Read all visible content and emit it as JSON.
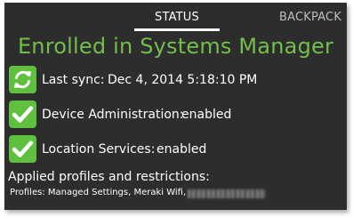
{
  "tabs": [
    {
      "label": "STATUS",
      "selected": true
    },
    {
      "label": "BACKPACK",
      "selected": false
    }
  ],
  "status": {
    "headline": "Enrolled in Systems Manager",
    "last_sync": {
      "label": "Last sync:",
      "value": "Dec 4, 2014 5:18:10 PM",
      "icon": "sync-icon"
    },
    "device_admin": {
      "label": "Device Administration:",
      "value": "enabled",
      "icon": "checkmark-icon"
    },
    "location_services": {
      "label": "Location Services:",
      "value": "enabled",
      "icon": "checkmark-icon"
    },
    "applied_heading": "Applied profiles and restrictions:",
    "profiles_text": "Profiles: Managed Settings, Meraki Wifi,"
  },
  "colors": {
    "background": "#2d2d2d",
    "accent_green": "#72bf4a",
    "icon_green": "#5fbf3f",
    "text": "#ffffff"
  }
}
